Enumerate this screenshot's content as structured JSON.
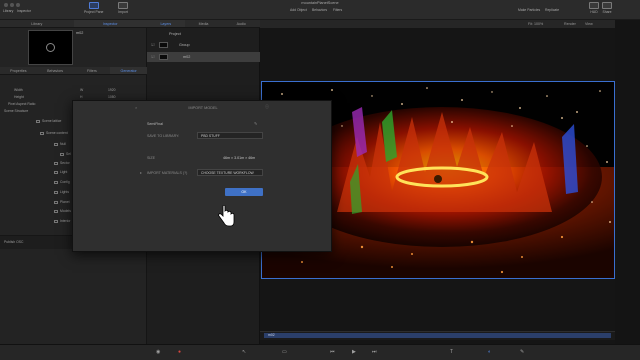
{
  "window": {
    "title": "mountainPlanetScene"
  },
  "toolbar": {
    "left": [
      {
        "label": "Library"
      },
      {
        "label": "Inspector"
      },
      {
        "label": "Project Pane"
      },
      {
        "label": "Import"
      }
    ],
    "center": [
      {
        "label": "Add Object"
      },
      {
        "label": "Behaviors"
      },
      {
        "label": "Filters"
      }
    ],
    "right": [
      {
        "label": "Make Particles"
      },
      {
        "label": "Replicate"
      },
      {
        "label": "HUD"
      },
      {
        "label": "Share"
      }
    ]
  },
  "left_panel": {
    "top_tabs": [
      "Library",
      "Inspector"
    ],
    "object_name": "m02",
    "tabs": [
      "Properties",
      "Behaviors",
      "Filters",
      "Generator"
    ],
    "props": [
      {
        "key": "Width",
        "unit": "W",
        "value": "1920"
      },
      {
        "key": "Height",
        "unit": "H",
        "value": "1080"
      },
      {
        "key": "Pixel Aspect Ratio",
        "unit": "",
        "value": "1.00"
      }
    ],
    "scene_header": "Scene Structure",
    "tree": [
      "Scene lattice",
      "Scene content",
      "Null",
      "Sel",
      "Sector",
      "Light",
      "Config",
      "Lights",
      "Planet",
      "Models",
      "Interior"
    ],
    "footer": "Publish OSC"
  },
  "layers": {
    "tabs": [
      "Layers",
      "Media",
      "Audio"
    ],
    "items": [
      {
        "name": "Project"
      },
      {
        "name": "Group"
      },
      {
        "name": "m02"
      }
    ]
  },
  "canvas_bar": {
    "zoom": "Fit: 100%",
    "render": "Render",
    "view": "View"
  },
  "dialog": {
    "title": "IMPORT MODEL",
    "filename": "SemiFinal",
    "save_label": "SAVE TO LIBRARY:",
    "save_value": "PBD STUFF",
    "size_label": "SIZE",
    "size_value": "46m × 3.01m × 46m",
    "materials_label": "IMPORT MATERIALS (?)",
    "materials_value": "CHOOSE TEXTURE WORKFLOW",
    "ok": "OK"
  },
  "timeline": {
    "label": "m02"
  },
  "colors": {
    "accent": "#3f71c6",
    "selection": "#3a6fd0",
    "record": "#d8463f"
  }
}
